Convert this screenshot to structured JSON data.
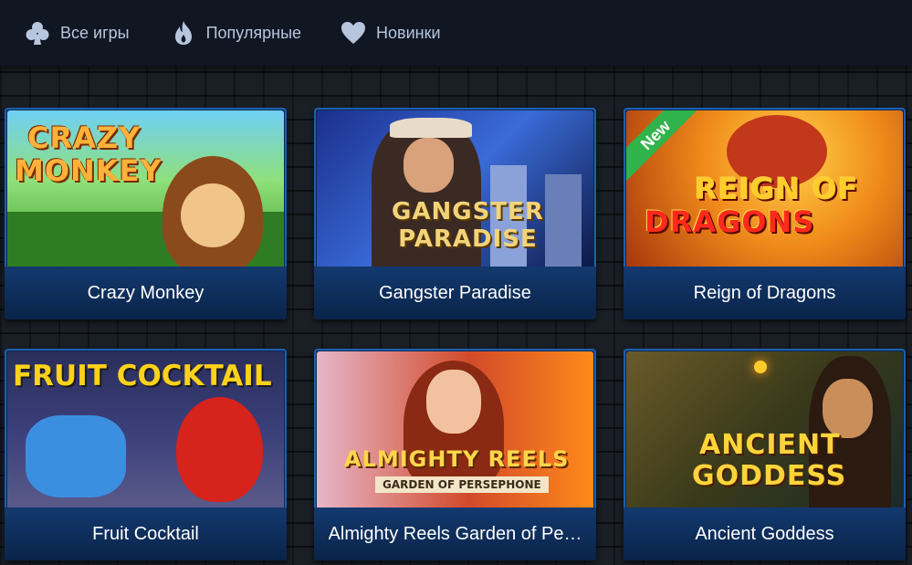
{
  "nav": {
    "items": [
      {
        "label": "Все игры",
        "icon": "club-icon"
      },
      {
        "label": "Популярные",
        "icon": "flame-icon"
      },
      {
        "label": "Новинки",
        "icon": "heart-icon"
      }
    ]
  },
  "games": [
    {
      "title": "Crazy Monkey",
      "logo_line1": "Crazy",
      "logo_line2": "Monkey",
      "badge": ""
    },
    {
      "title": "Gangster Paradise",
      "logo_line1": "Gangster",
      "logo_line2": "Paradise",
      "badge": ""
    },
    {
      "title": "Reign of Dragons",
      "logo_line1": "Reign of",
      "logo_line2": "Dragons",
      "badge": "New"
    },
    {
      "title": "Fruit Cocktail",
      "logo_line1": "Fruit Cocktail",
      "logo_line2": "",
      "badge": ""
    },
    {
      "title": "Almighty Reels Garden of Pe…",
      "logo_line1": "Almighty Reels",
      "logo_line2": "Garden of Persephone",
      "badge": ""
    },
    {
      "title": "Ancient Goddess",
      "logo_line1": "Ancient",
      "logo_line2": "Goddess",
      "badge": ""
    }
  ],
  "colors": {
    "nav_text": "#b7c6dd",
    "card_border": "#1d5fae",
    "caption_bg": "#0b2a56",
    "badge_green": "#2fb34a"
  }
}
